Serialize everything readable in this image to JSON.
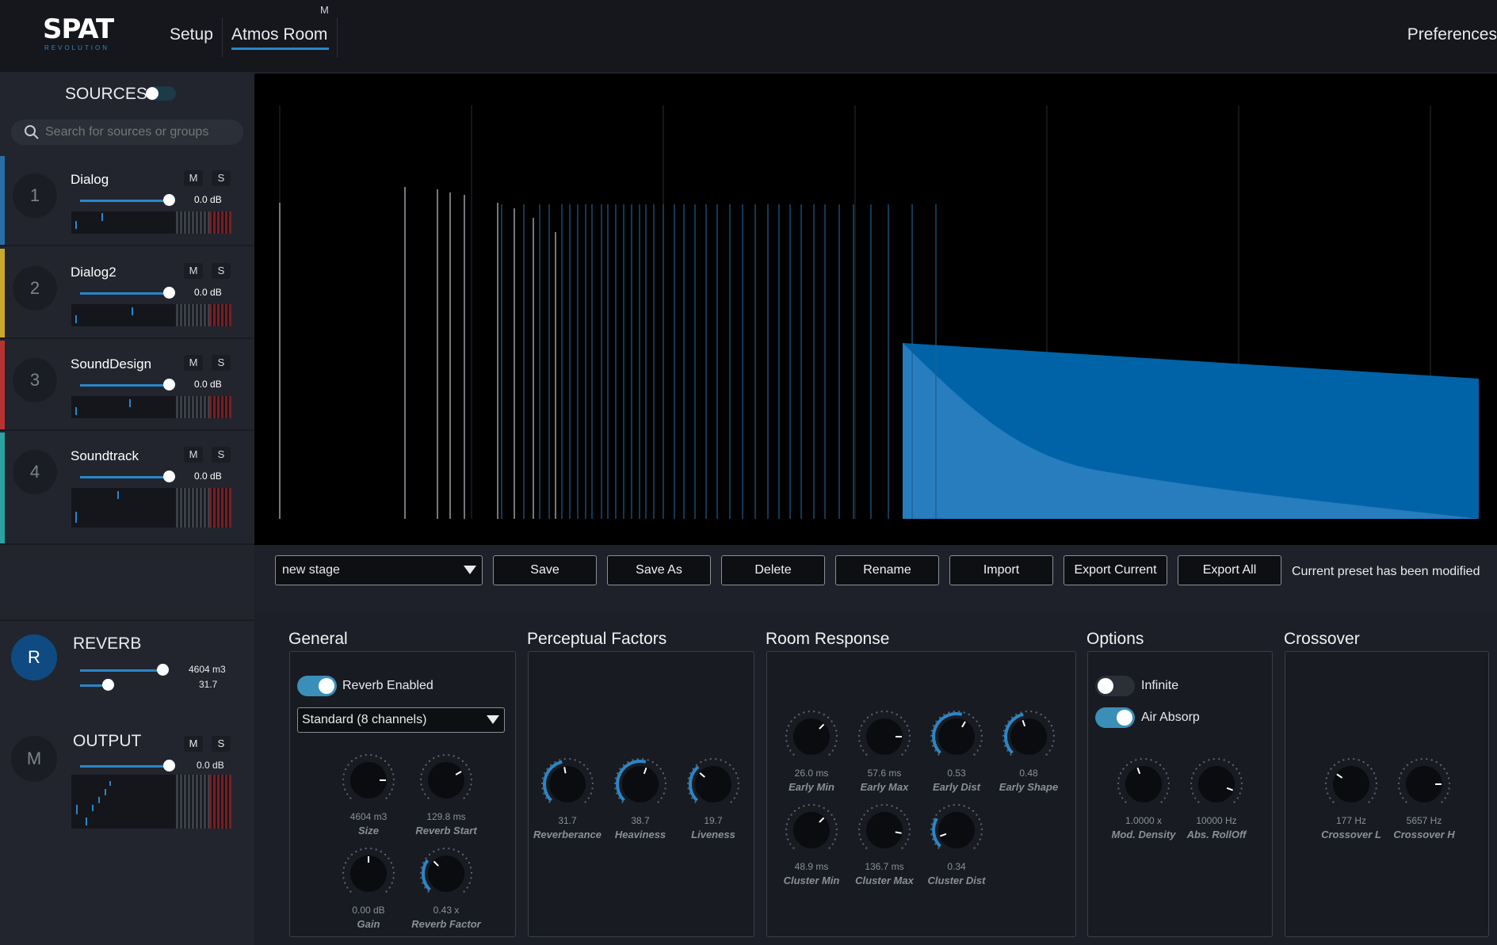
{
  "app": {
    "logo_main": "SPAT",
    "logo_sub": "REVOLUTION",
    "tabs": [
      {
        "label": "Setup"
      },
      {
        "label": "Atmos Room"
      }
    ],
    "tab_marker": "M",
    "preferences": "Preferences"
  },
  "colors": {
    "accent": "#2a86c8",
    "dialog": "#2a6ea8",
    "dialog2": "#c9a92a",
    "sounddesign": "#b83232",
    "soundtrack": "#2ba3a3"
  },
  "sidebar": {
    "title": "SOURCES",
    "search_placeholder": "Search for sources or groups",
    "sources": [
      {
        "num": "1",
        "name": "Dialog",
        "gain": "0.0 dB",
        "mute": "M",
        "solo": "S"
      },
      {
        "num": "2",
        "name": "Dialog2",
        "gain": "0.0 dB",
        "mute": "M",
        "solo": "S"
      },
      {
        "num": "3",
        "name": "SoundDesign",
        "gain": "0.0 dB",
        "mute": "M",
        "solo": "S"
      },
      {
        "num": "4",
        "name": "Soundtrack",
        "gain": "0.0 dB",
        "mute": "M",
        "solo": "S"
      }
    ],
    "reverb": {
      "badge": "R",
      "label": "REVERB",
      "size": "4604 m3",
      "value2": "31.7"
    },
    "output": {
      "badge": "M",
      "label": "OUTPUT",
      "gain": "0.0 dB",
      "mute": "M",
      "solo": "S"
    }
  },
  "presets": {
    "current": "new stage",
    "buttons": [
      "Save",
      "Save As",
      "Delete",
      "Rename",
      "Import",
      "Export Current",
      "Export All"
    ],
    "status": "Current preset has been modified"
  },
  "sections": {
    "general": {
      "title": "General",
      "reverb_enabled": "Reverb Enabled",
      "mode": "Standard (8 channels)",
      "knobs": [
        {
          "value": "4604 m3",
          "label": "Size"
        },
        {
          "value": "129.8 ms",
          "label": "Reverb Start"
        },
        {
          "value": "0.00 dB",
          "label": "Gain"
        },
        {
          "value": "0.43 x",
          "label": "Reverb Factor"
        }
      ]
    },
    "perceptual": {
      "title": "Perceptual Factors",
      "knobs": [
        {
          "value": "31.7",
          "label": "Reverberance"
        },
        {
          "value": "38.7",
          "label": "Heaviness"
        },
        {
          "value": "19.7",
          "label": "Liveness"
        }
      ]
    },
    "room": {
      "title": "Room Response",
      "knobs": [
        {
          "value": "26.0 ms",
          "label": "Early Min"
        },
        {
          "value": "57.6 ms",
          "label": "Early Max"
        },
        {
          "value": "0.53",
          "label": "Early Dist"
        },
        {
          "value": "0.48",
          "label": "Early Shape"
        },
        {
          "value": "48.9 ms",
          "label": "Cluster Min"
        },
        {
          "value": "136.7 ms",
          "label": "Cluster Max"
        },
        {
          "value": "0.34",
          "label": "Cluster Dist"
        }
      ]
    },
    "options": {
      "title": "Options",
      "infinite": "Infinite",
      "air_absorp": "Air Absorp",
      "knobs": [
        {
          "value": "1.0000 x",
          "label": "Mod. Density"
        },
        {
          "value": "10000 Hz",
          "label": "Abs. RollOff"
        }
      ]
    },
    "crossover": {
      "title": "Crossover",
      "knobs": [
        {
          "value": "177 Hz",
          "label": "Crossover L"
        },
        {
          "value": "5657 Hz",
          "label": "Crossover H"
        }
      ]
    }
  }
}
